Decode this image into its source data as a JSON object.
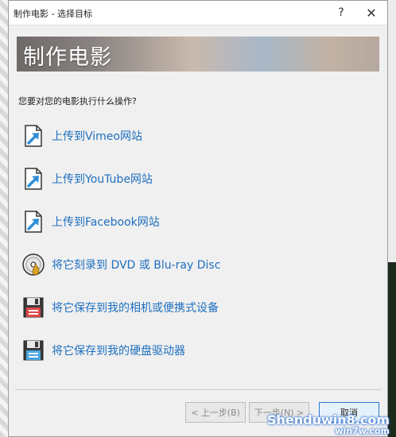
{
  "window": {
    "title": "制作电影 - 选择目标",
    "help_glyph": "?",
    "close_glyph": "✕"
  },
  "banner": {
    "title": "制作电影"
  },
  "prompt": "您要对您的电影执行什么操作?",
  "options": [
    {
      "label": "上传到Vimeo网站",
      "icon": "upload-doc-icon"
    },
    {
      "label": "上传到YouTube网站",
      "icon": "upload-doc-icon"
    },
    {
      "label": "上传到Facebook网站",
      "icon": "upload-doc-icon"
    },
    {
      "label": "将它刻录到 DVD 或 Blu-ray Disc",
      "icon": "disc-burn-icon"
    },
    {
      "label": "将它保存到我的相机或便携式设备",
      "icon": "floppy-red-icon"
    },
    {
      "label": "将它保存到我的硬盘驱动器",
      "icon": "floppy-blue-icon"
    }
  ],
  "buttons": {
    "back": "< 上一步(B)",
    "next": "下一步(N) >",
    "cancel": "取消"
  },
  "watermark": {
    "line1": "Shenduwin8.com",
    "line2": "win7w.com"
  },
  "colors": {
    "link": "#1e6fbf",
    "dialog_bg": "#f0f0f0",
    "accent": "#2b7bd4"
  }
}
